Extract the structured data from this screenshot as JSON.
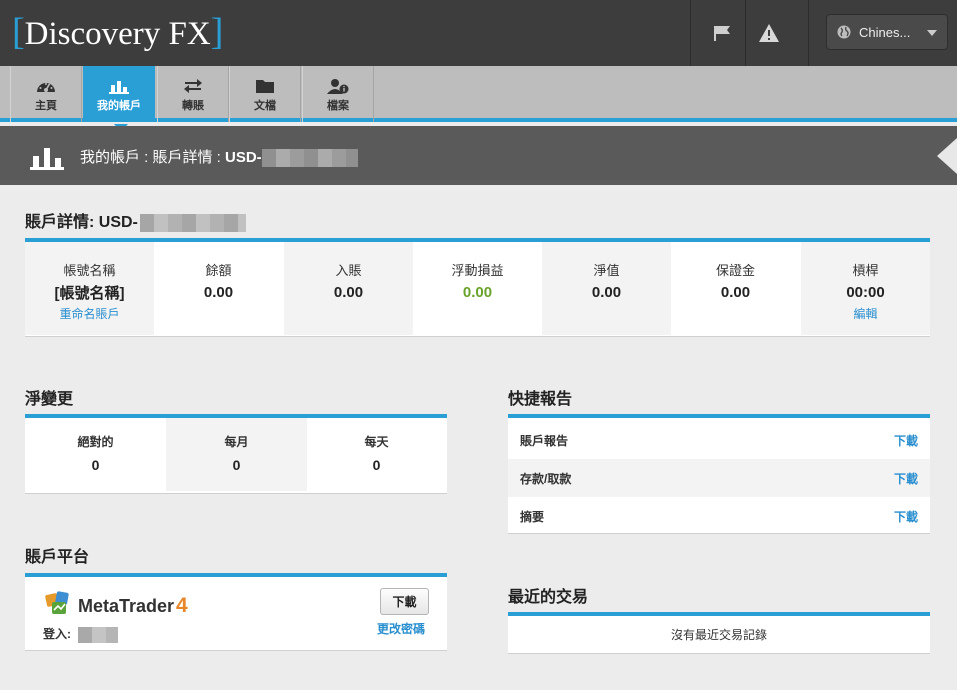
{
  "brand": {
    "name": "Discovery FX",
    "open_bracket": "[",
    "close_bracket": "]"
  },
  "topbar": {
    "language_label": "Chines...",
    "flag_icon": "flag-icon",
    "alert_icon": "warning-icon",
    "globe_icon": "globe-icon"
  },
  "nav": {
    "tabs": [
      {
        "label": "主頁",
        "icon": "dashboard-icon",
        "active": false
      },
      {
        "label": "我的帳戶",
        "icon": "bar-chart-icon",
        "active": true
      },
      {
        "label": "轉賬",
        "icon": "transfer-arrows-icon",
        "active": false
      },
      {
        "label": "文檔",
        "icon": "folder-icon",
        "active": false
      },
      {
        "label": "檔案",
        "icon": "user-info-icon",
        "active": false
      }
    ]
  },
  "breadcrumb": {
    "text": "我的帳戶 : 賬戶詳情 :",
    "account": "USD-"
  },
  "account_details": {
    "title": "賬戶詳情: USD-",
    "columns": [
      {
        "label": "帳號名稱",
        "value": "[帳號名稱]",
        "link": "重命名賬戶"
      },
      {
        "label": "餘額",
        "value": "0.00"
      },
      {
        "label": "入賬",
        "value": "0.00"
      },
      {
        "label": "浮動損益",
        "value": "0.00",
        "color": "#6aa32a"
      },
      {
        "label": "淨值",
        "value": "0.00"
      },
      {
        "label": "保證金",
        "value": "0.00"
      },
      {
        "label": "槓桿",
        "value": "00:00",
        "link": "編輯"
      }
    ]
  },
  "net_change": {
    "title": "淨變更",
    "columns": [
      {
        "label": "絕對的",
        "value": "0"
      },
      {
        "label": "每月",
        "value": "0"
      },
      {
        "label": "每天",
        "value": "0"
      }
    ]
  },
  "quick_reports": {
    "title": "快捷報告",
    "rows": [
      {
        "label": "賬戶報告",
        "action": "下載"
      },
      {
        "label": "存款/取款",
        "action": "下載"
      },
      {
        "label": "摘要",
        "action": "下載"
      }
    ]
  },
  "platform": {
    "title": "賬戶平台",
    "name": "MetaTrader",
    "version": "4",
    "login_label": "登入:",
    "download_button": "下載",
    "change_password": "更改密碼"
  },
  "recent_trades": {
    "title": "最近的交易",
    "empty_message": "沒有最近交易記錄"
  },
  "colors": {
    "accent": "#2a9fd6",
    "positive": "#6aa32a",
    "link": "#2a8fcf",
    "topbar": "#3d3d3d"
  }
}
